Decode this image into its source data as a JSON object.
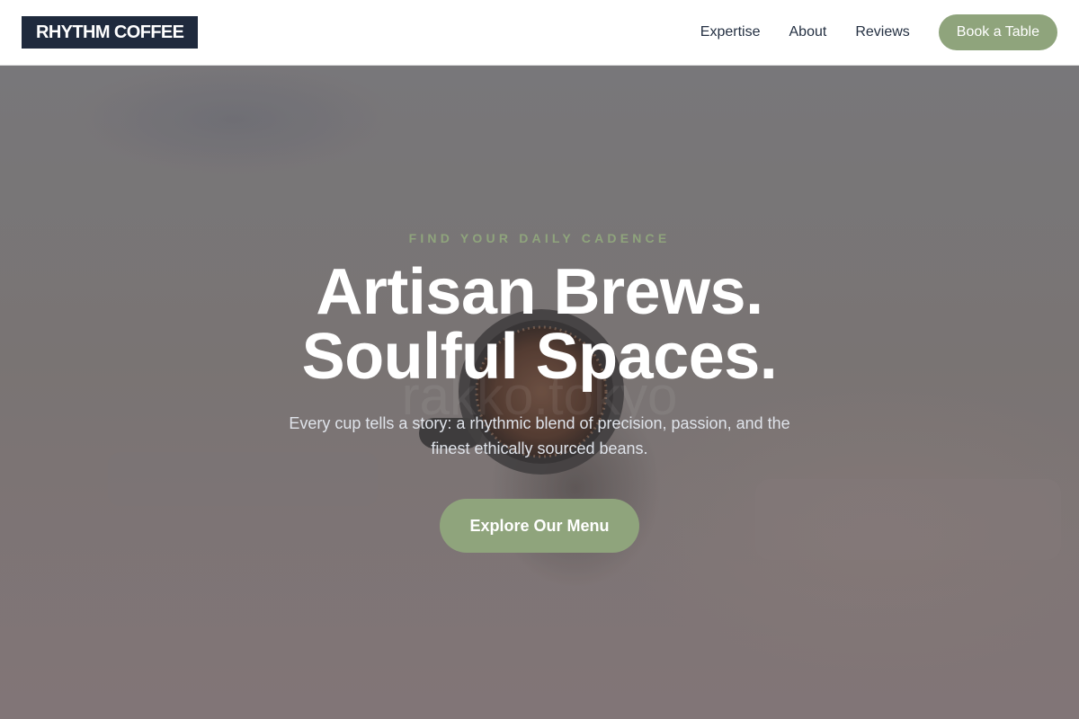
{
  "header": {
    "logo": "RHYTHM COFFEE",
    "nav": [
      {
        "label": "Expertise"
      },
      {
        "label": "About"
      },
      {
        "label": "Reviews"
      }
    ],
    "cta_label": "Book a Table"
  },
  "hero": {
    "eyebrow": "FIND YOUR DAILY CADENCE",
    "headline_line1": "Artisan Brews.",
    "headline_line2": "Soulful Spaces.",
    "subtitle": "Every cup tells a story: a rhythmic blend of precision, passion, and the finest ethically sourced beans.",
    "cta_label": "Explore Our Menu",
    "watermark": "rakko.tokyo"
  },
  "colors": {
    "brand_dark": "#1f2a3d",
    "accent_sage": "#8fa47c",
    "nav_text": "#243042"
  }
}
